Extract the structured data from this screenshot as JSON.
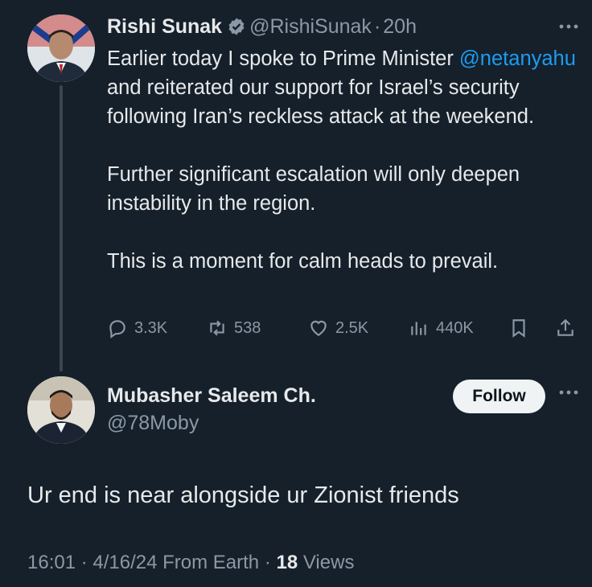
{
  "tweet": {
    "author_name": "Rishi Sunak",
    "handle": "@RishiSunak",
    "separator": "·",
    "time": "20h",
    "more_icon": "more-horizontal-icon",
    "body_line1_a": "Earlier today I spoke to Prime Minister",
    "mention": "@netanyahu",
    "body_line1_b": " and reiterated our support for Israel’s security following Iran’s reckless attack at the weekend.",
    "body_p2": "Further significant escalation will only deepen instability in the region.",
    "body_p3": "This is a moment for calm heads to prevail.",
    "stats": {
      "replies": "3.3K",
      "reposts": "538",
      "likes": "2.5K",
      "views": "440K"
    }
  },
  "reply": {
    "author_name": "Mubasher Saleem Ch.",
    "handle": "@78Moby",
    "follow_label": "Follow",
    "text": "Ur end is near alongside ur Zionist friends",
    "time": "16:01 · 4/16/24 From Earth · ",
    "views_count": "18",
    "views_label": " Views"
  },
  "colors": {
    "background": "#15202b",
    "accent": "#1d9bf0",
    "muted": "#8b98a5"
  }
}
